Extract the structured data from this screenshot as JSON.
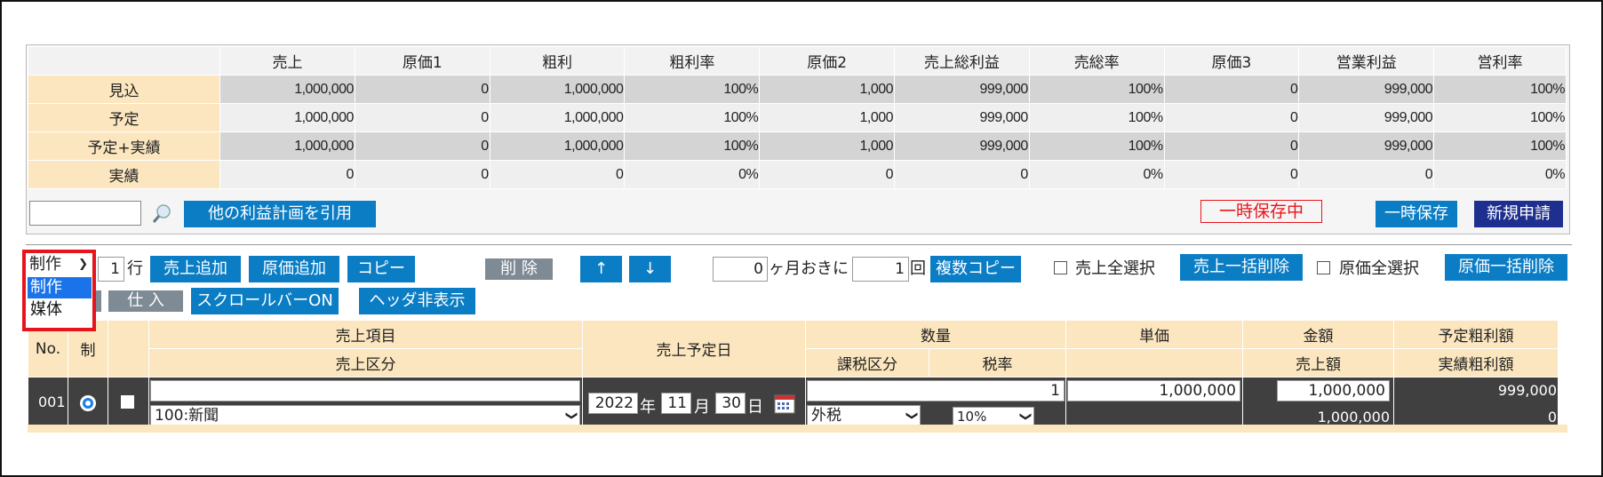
{
  "summary": {
    "headers": [
      "売上",
      "原価1",
      "粗利",
      "粗利率",
      "原価2",
      "売上総利益",
      "売総率",
      "原価3",
      "営業利益",
      "営利率"
    ],
    "rows": [
      {
        "label": "見込",
        "values": [
          "1,000,000",
          "0",
          "1,000,000",
          "100%",
          "1,000",
          "999,000",
          "100%",
          "0",
          "999,000",
          "100%"
        ]
      },
      {
        "label": "予定",
        "values": [
          "1,000,000",
          "0",
          "1,000,000",
          "100%",
          "1,000",
          "999,000",
          "100%",
          "0",
          "999,000",
          "100%"
        ]
      },
      {
        "label": "予定+実績",
        "values": [
          "1,000,000",
          "0",
          "1,000,000",
          "100%",
          "1,000",
          "999,000",
          "100%",
          "0",
          "999,000",
          "100%"
        ]
      },
      {
        "label": "実績",
        "values": [
          "0",
          "0",
          "0",
          "0%",
          "0",
          "0",
          "0%",
          "0",
          "0",
          "0%"
        ]
      }
    ],
    "cite_button": "他の利益計画を引用",
    "temp_saving_status": "一時保存中",
    "temp_save_button": "一時保存",
    "new_apply_button": "新規申請"
  },
  "toolbar": {
    "type_select": "制作",
    "type_options": [
      "制作",
      "媒体"
    ],
    "row_count": "1",
    "row_unit": "行",
    "add_sales": "売上追加",
    "add_cost": "原価追加",
    "copy": "コピー",
    "delete": "削 除",
    "up": "↑",
    "down": "↓",
    "months_value": "0",
    "months_label": "ヶ月おきに",
    "times_value": "1",
    "times_label": "回",
    "multi_copy": "複数コピー",
    "select_all_sales": "売上全選択",
    "bulk_delete_sales": "売上一括削除",
    "select_all_cost": "原価全選択",
    "bulk_delete_cost": "原価一括削除",
    "purchase": "仕 入",
    "scrollbar_on": "スクロールバーON",
    "hide_header": "ヘッダ非表示"
  },
  "detail": {
    "h_no": "No.",
    "h_sei": "制",
    "h_item": "売上項目",
    "h_category": "売上区分",
    "h_date": "売上予定日",
    "h_qty": "数量",
    "h_tax_type": "課税区分",
    "h_tax_rate": "税率",
    "h_unit_price": "単価",
    "h_amount": "金額",
    "h_sales_amount": "売上額",
    "h_planned_profit": "予定粗利額",
    "h_actual_profit": "実績粗利額",
    "row": {
      "no": "001",
      "item": "",
      "category": "100:新聞",
      "year": "2022",
      "year_unit": "年",
      "month": "11",
      "month_unit": "月",
      "day": "30",
      "day_unit": "日",
      "qty": "1",
      "tax_type": "外税",
      "tax_rate": "10%",
      "unit_price": "1,000,000",
      "amount": "1,000,000",
      "sales_amount": "1,000,000",
      "planned_profit": "999,000",
      "actual_profit": "0"
    }
  },
  "colors": {
    "accent": "#0b7dc4",
    "navy": "#1e2f8f",
    "header_beige": "#fbe6bf",
    "highlight": "#e8141b"
  }
}
